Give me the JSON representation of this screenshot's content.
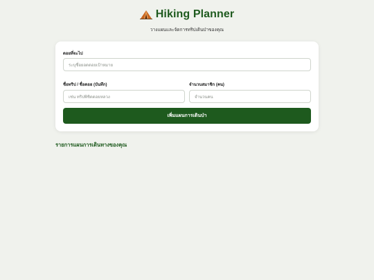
{
  "app": {
    "title": "Hiking Planner",
    "icon": "tent-icon",
    "subtitle": "วางแผนและจัดการทริปเดินป่าของคุณ"
  },
  "form": {
    "destination": {
      "label": "ดอยที่จะไป",
      "placeholder": "ระบุชื่อยอดดอยเป้าหมาย",
      "value": ""
    },
    "trip_name": {
      "label": "ชื่อทริป / ชื่อดอย (บันทึก)",
      "placeholder": "เช่น ทริปพิชิตดอยหลวง",
      "value": ""
    },
    "members": {
      "label": "จำนวนสมาชิก (คน)",
      "placeholder": "จำนวนคน",
      "value": ""
    },
    "submit_label": "เพิ่มแผนการเดินป่า"
  },
  "plans": {
    "section_title": "รายการแผนการเดินทางของคุณ",
    "items": []
  },
  "colors": {
    "accent": "#1e5a1e",
    "background": "#f0f2ed",
    "card": "#ffffff"
  }
}
